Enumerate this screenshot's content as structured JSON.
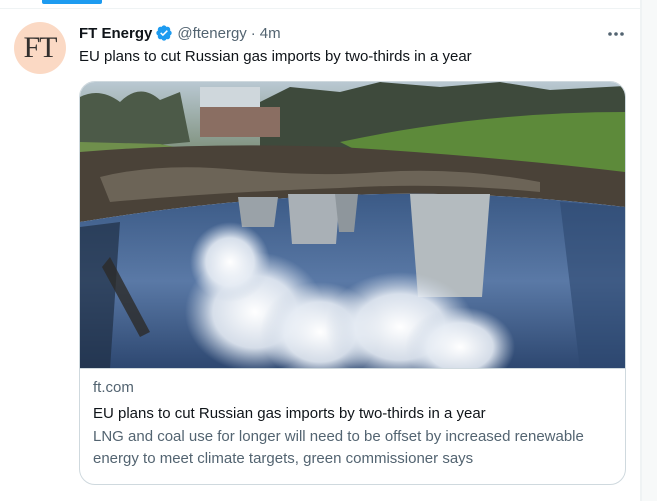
{
  "tweet": {
    "avatar_text": "FT",
    "author_name": "FT Energy",
    "handle": "@ftenergy",
    "separator": "·",
    "time": "4m",
    "text": "EU plans to cut Russian gas imports by two-thirds in a year"
  },
  "card": {
    "image_icon": "photo-cooling-towers-reflected-in-puddle",
    "domain": "ft.com",
    "title": "EU plans to cut Russian gas imports by two-thirds in a year",
    "description": "LNG and coal use for longer will need to be offset by increased renewable energy to meet climate targets, green commissioner says"
  },
  "colors": {
    "accent": "#1d9bf0",
    "text_primary": "#0f1419",
    "text_secondary": "#536471",
    "border": "#cfd9de",
    "avatar_bg": "#fbd9c4"
  },
  "icons": {
    "verified": "verified-badge-icon",
    "more": "more-options-icon"
  }
}
